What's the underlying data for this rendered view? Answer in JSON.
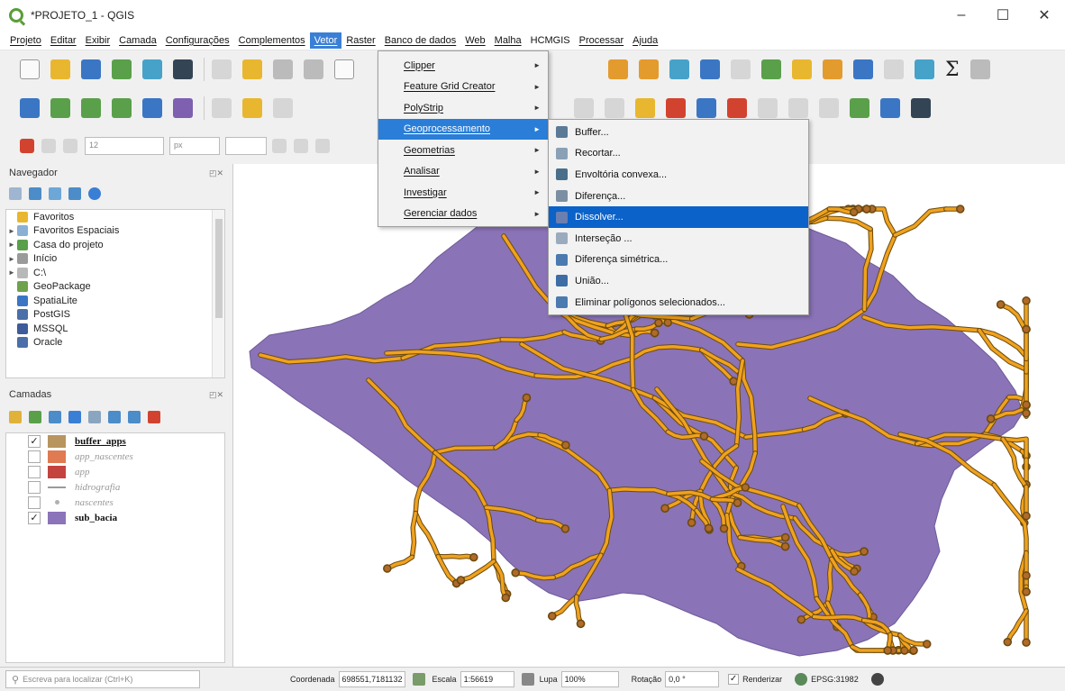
{
  "window": {
    "title": "*PROJETO_1 - QGIS",
    "minimize": "–",
    "maximize": "☐",
    "close": "✕"
  },
  "menubar": {
    "items": [
      "Projeto",
      "Editar",
      "Exibir",
      "Camada",
      "Configurações",
      "Complementos",
      "Vetor",
      "Raster",
      "Banco de dados",
      "Web",
      "Malha",
      "HCMGIS",
      "Processar",
      "Ajuda"
    ],
    "active": "Vetor"
  },
  "toolbar": {
    "scale_input": "12",
    "units_input": "px"
  },
  "navigator": {
    "title": "Navegador",
    "items": [
      {
        "label": "Favoritos",
        "icon": "star-icon",
        "color": "#e8b72f",
        "arrow": ""
      },
      {
        "label": "Favoritos Espaciais",
        "icon": "spatial-bookmark-icon",
        "color": "#8ab0d6",
        "arrow": "►"
      },
      {
        "label": "Casa do projeto",
        "icon": "project-home-icon",
        "color": "#5aa04a",
        "arrow": "►"
      },
      {
        "label": "Início",
        "icon": "home-icon",
        "color": "#9a9a9a",
        "arrow": "►"
      },
      {
        "label": "C:\\",
        "icon": "drive-icon",
        "color": "#b8b8b8",
        "arrow": "►"
      },
      {
        "label": "GeoPackage",
        "icon": "geopackage-icon",
        "color": "#6ea34c",
        "arrow": ""
      },
      {
        "label": "SpatiaLite",
        "icon": "spatialite-icon",
        "color": "#3b76c4",
        "arrow": ""
      },
      {
        "label": "PostGIS",
        "icon": "postgis-icon",
        "color": "#4b6fa8",
        "arrow": ""
      },
      {
        "label": "MSSQL",
        "icon": "mssql-icon",
        "color": "#3e5b9a",
        "arrow": ""
      },
      {
        "label": "Oracle",
        "icon": "oracle-icon",
        "color": "#4b6fa8",
        "arrow": ""
      }
    ]
  },
  "layers": {
    "title": "Camadas",
    "items": [
      {
        "name": "buffer_apps",
        "checked": true,
        "color": "#b8955e",
        "style": "bold underline",
        "swatch": "box"
      },
      {
        "name": "app_nascentes",
        "checked": false,
        "color": "#e07a52",
        "style": "italic",
        "swatch": "box"
      },
      {
        "name": "app",
        "checked": false,
        "color": "#c5433e",
        "style": "italic",
        "swatch": "box"
      },
      {
        "name": "hidrografia",
        "checked": false,
        "color": "#9a9a9a",
        "style": "italic",
        "swatch": "line"
      },
      {
        "name": "nascentes",
        "checked": false,
        "color": "#b0b0b0",
        "style": "italic",
        "swatch": "dot"
      },
      {
        "name": "sub_bacia",
        "checked": true,
        "color": "#8b74b9",
        "style": "bold",
        "swatch": "box"
      }
    ]
  },
  "vetor_menu": {
    "items": [
      {
        "label": "Clipper",
        "submenu": true
      },
      {
        "label": "Feature Grid Creator",
        "submenu": true
      },
      {
        "label": "PolyStrip",
        "submenu": true
      },
      {
        "label": "Geoprocessamento",
        "submenu": true,
        "highlighted": true
      },
      {
        "label": "Geometrias",
        "submenu": true
      },
      {
        "label": "Analisar",
        "submenu": true
      },
      {
        "label": "Investigar",
        "submenu": true
      },
      {
        "label": "Gerenciar dados",
        "submenu": true
      }
    ]
  },
  "geoprocessamento_menu": {
    "items": [
      {
        "label": "Buffer...",
        "icon": "buffer-icon"
      },
      {
        "label": "Recortar...",
        "icon": "clip-icon"
      },
      {
        "label": "Envoltória convexa...",
        "icon": "convex-hull-icon"
      },
      {
        "label": "Diferença...",
        "icon": "difference-icon"
      },
      {
        "label": "Dissolver...",
        "icon": "dissolve-icon",
        "highlighted": true
      },
      {
        "label": "Interseção ...",
        "icon": "intersection-icon"
      },
      {
        "label": "Diferença simétrica...",
        "icon": "symmetric-difference-icon"
      },
      {
        "label": "União...",
        "icon": "union-icon"
      },
      {
        "label": "Eliminar polígonos selecionados...",
        "icon": "eliminate-icon"
      }
    ]
  },
  "map": {
    "basin_color": "#8a73b7",
    "basin_stroke": "#6e5a99",
    "drainage_color": "#f0a21e",
    "drainage_outline": "#6b4a0e"
  },
  "statusbar": {
    "search_placeholder": "Escreva para localizar (Ctrl+K)",
    "coord_label": "Coordenada",
    "coord_value": "698551,7181132",
    "scale_label": "Escala",
    "scale_value": "1:56619",
    "magnifier_label": "Lupa",
    "magnifier_value": "100%",
    "rotation_label": "Rotação",
    "rotation_value": "0,0 °",
    "render_label": "Renderizar",
    "crs": "EPSG:31982"
  }
}
